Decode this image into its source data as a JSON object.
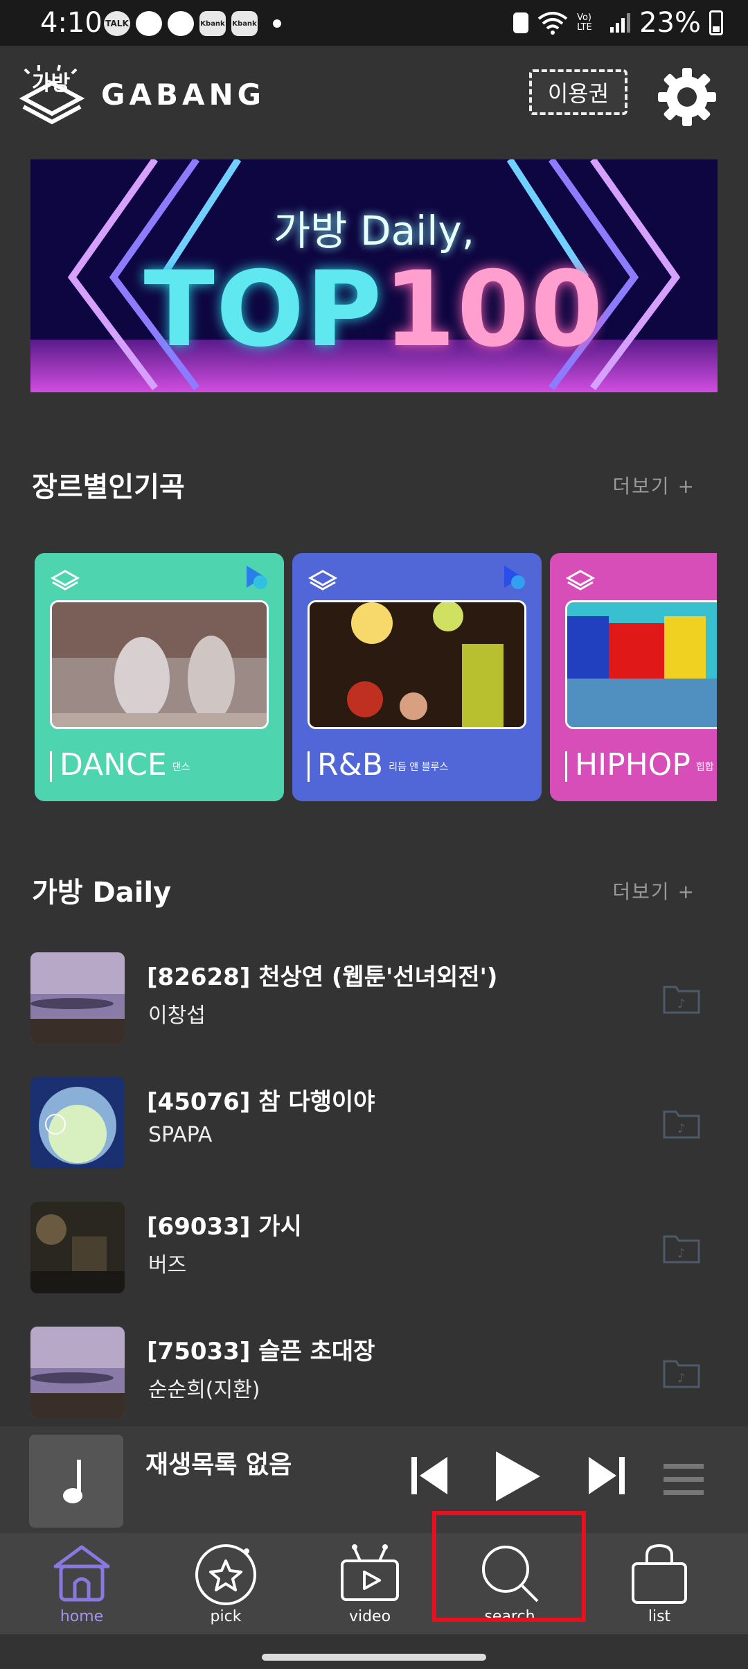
{
  "status_bar": {
    "time": "4:10",
    "notifications": [
      "TALK",
      "Kbank",
      "Kbank"
    ],
    "network": "Vo) LTE",
    "battery": "23%"
  },
  "header": {
    "logo_text": "GABANG",
    "ticket_label": "이용권",
    "settings_icon": "gear-icon"
  },
  "banner": {
    "subtitle": "가방 Daily,",
    "title_part1": "TOP",
    "title_part2": "100"
  },
  "genre_section": {
    "title": "장르별인기곡",
    "more_label": "더보기 +",
    "cards": [
      {
        "name": "DANCE",
        "sub": "댄스",
        "color": "#4ed4ae"
      },
      {
        "name": "R&B",
        "sub": "리듬 앤 블루스",
        "color": "#5167d8"
      },
      {
        "name": "HIPHOP",
        "sub": "힙합",
        "color": "#d84eb8"
      }
    ]
  },
  "daily_section": {
    "title": "가방 Daily",
    "more_label": "더보기 +",
    "songs": [
      {
        "title": "[82628] 천상연 (웹툰'선녀외전')",
        "artist": "이창섭"
      },
      {
        "title": "[45076] 참 다행이야",
        "artist": "SPAPA"
      },
      {
        "title": "[69033] 가시",
        "artist": "버즈"
      },
      {
        "title": "[75033] 슬픈 초대장",
        "artist": "순순희(지환)"
      }
    ]
  },
  "player": {
    "now_playing": "재생목록 없음"
  },
  "bottom_nav": {
    "items": [
      {
        "label": "home"
      },
      {
        "label": "pick"
      },
      {
        "label": "video"
      },
      {
        "label": "search"
      },
      {
        "label": "list"
      }
    ]
  },
  "colors": {
    "background": "#333333",
    "nav_active": "#a593e8",
    "highlight": "#e8101e"
  }
}
